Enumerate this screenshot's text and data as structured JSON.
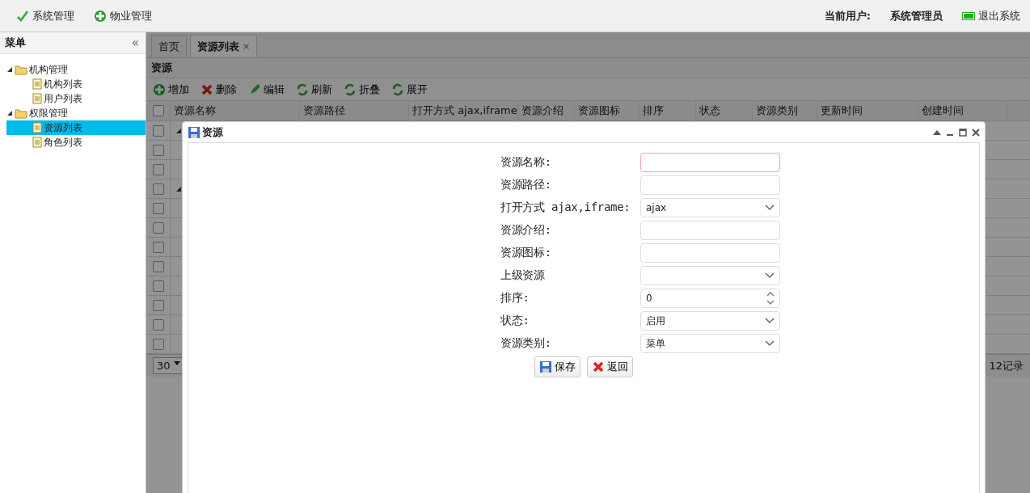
{
  "top_menu": [
    {
      "label": "系统管理",
      "kind": "confirm"
    },
    {
      "label": "物业管理",
      "kind": "add"
    }
  ],
  "user": {
    "label": "当前用户:",
    "name": "系统管理员"
  },
  "logout": {
    "label": "退出系统"
  },
  "sidebar": {
    "title": "菜单",
    "collapse": "«",
    "tree": [
      {
        "label": "机构管理",
        "expanded": true,
        "children": [
          {
            "label": "机构列表",
            "selected": false
          },
          {
            "label": "用户列表",
            "selected": false
          }
        ]
      },
      {
        "label": "权限管理",
        "expanded": true,
        "children": [
          {
            "label": "资源列表",
            "selected": true
          },
          {
            "label": "角色列表",
            "selected": false
          }
        ]
      }
    ]
  },
  "tabs": [
    {
      "label": "首页",
      "selected": false,
      "closable": false
    },
    {
      "label": "资源列表",
      "selected": true,
      "closable": true,
      "close": "×"
    }
  ],
  "panel_title": "资源",
  "toolbar": [
    {
      "label": "增加",
      "kind": "add"
    },
    {
      "label": "删除",
      "kind": "delete"
    },
    {
      "label": "编辑",
      "kind": "edit"
    },
    {
      "label": "刷新",
      "kind": "reload"
    },
    {
      "label": "折叠",
      "kind": "reload"
    },
    {
      "label": "展开",
      "kind": "reload"
    }
  ],
  "table": {
    "all_checked": false,
    "columns": [
      "资源名称",
      "资源路径",
      "打开方式 ajax,iframe",
      "资源介绍",
      "资源图标",
      "排序",
      "状态",
      "资源类别",
      "更新时间",
      "创建时间"
    ],
    "rows": [
      {
        "checked": false,
        "expanded": true
      },
      {
        "checked": false
      },
      {
        "checked": false
      },
      {
        "checked": false,
        "expanded": true
      },
      {
        "checked": false
      },
      {
        "checked": false
      },
      {
        "checked": false
      },
      {
        "checked": false
      },
      {
        "checked": false
      },
      {
        "checked": false
      },
      {
        "checked": false
      },
      {
        "checked": false
      }
    ]
  },
  "pager": {
    "page_size": "30",
    "total": "12记录"
  },
  "dialog": {
    "title": "资源",
    "fields": [
      {
        "kind": "text",
        "label": "资源名称:",
        "invalid": true
      },
      {
        "kind": "text",
        "label": "资源路径:",
        "invalid": false
      },
      {
        "kind": "select",
        "label": "打开方式 ajax,iframe:",
        "value": "ajax"
      },
      {
        "kind": "text",
        "label": "资源介绍:",
        "invalid": false
      },
      {
        "kind": "text",
        "label": "资源图标:",
        "invalid": false
      },
      {
        "kind": "select",
        "label": "上级资源"
      },
      {
        "kind": "number",
        "label": "排序:",
        "value": "0"
      },
      {
        "kind": "select",
        "label": "状态:",
        "value": "启用"
      },
      {
        "kind": "select",
        "label": "资源类别:",
        "value": "菜单"
      }
    ],
    "buttons": [
      {
        "label": "保存",
        "kind": "save"
      },
      {
        "label": "返回",
        "kind": "delete"
      }
    ]
  }
}
